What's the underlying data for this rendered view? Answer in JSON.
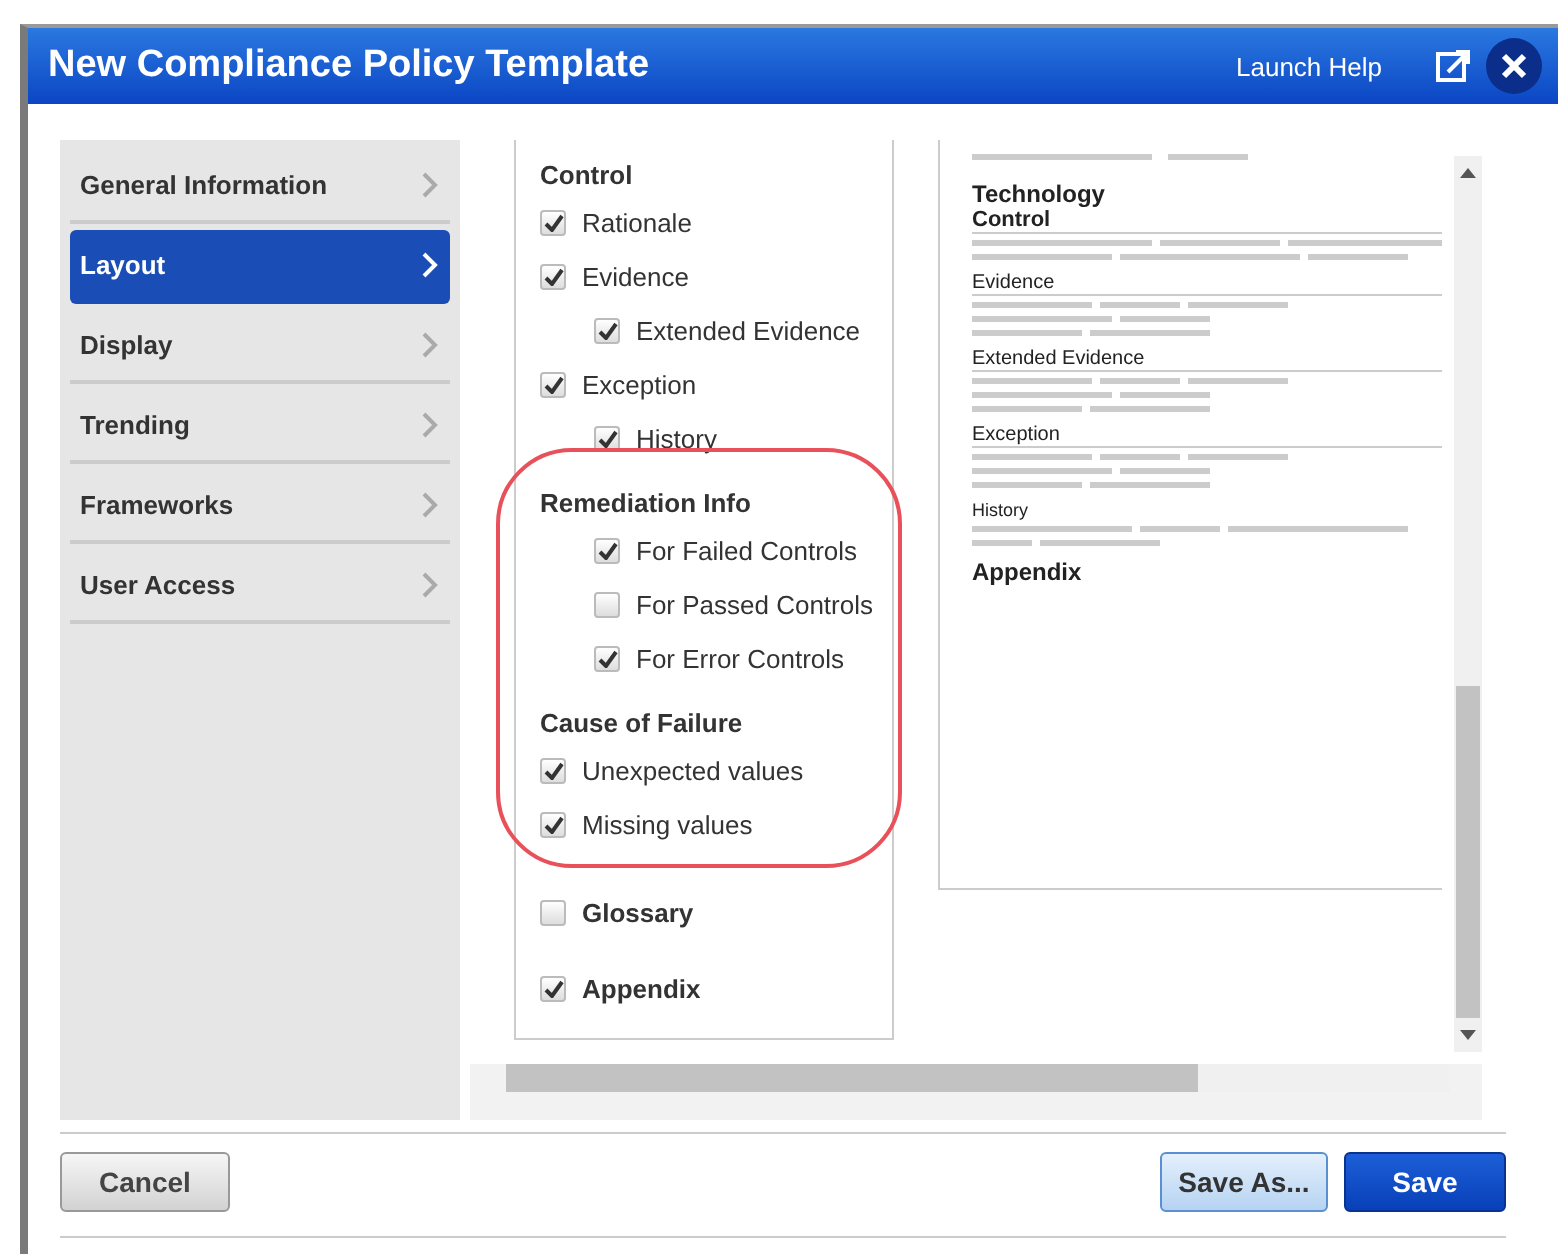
{
  "window": {
    "title": "New Compliance Policy Template",
    "help_link": "Launch Help"
  },
  "sidebar": {
    "items": [
      {
        "label": "General Information",
        "selected": false
      },
      {
        "label": "Layout",
        "selected": true
      },
      {
        "label": "Display",
        "selected": false
      },
      {
        "label": "Trending",
        "selected": false
      },
      {
        "label": "Frameworks",
        "selected": false
      },
      {
        "label": "User Access",
        "selected": false
      }
    ]
  },
  "options": [
    {
      "kind": "heading",
      "label": "Control",
      "children": [
        {
          "label": "Rationale",
          "checked": true
        },
        {
          "label": "Evidence",
          "checked": true,
          "children": [
            {
              "label": "Extended Evidence",
              "checked": true
            }
          ]
        },
        {
          "label": "Exception",
          "checked": true,
          "children": [
            {
              "label": "History",
              "checked": true
            }
          ]
        }
      ]
    },
    {
      "kind": "heading-deep",
      "label": "Remediation Info",
      "children": [
        {
          "label": "For Failed Controls",
          "checked": true
        },
        {
          "label": "For Passed Controls",
          "checked": false
        },
        {
          "label": "For Error Controls",
          "checked": true
        }
      ]
    },
    {
      "kind": "heading",
      "label": "Cause of Failure",
      "children": [
        {
          "label": "Unexpected values",
          "checked": true
        },
        {
          "label": "Missing values",
          "checked": true
        }
      ]
    },
    {
      "kind": "section",
      "label": "Glossary",
      "checked": false
    },
    {
      "kind": "section",
      "label": "Appendix",
      "checked": true
    }
  ],
  "preview": {
    "sections": [
      {
        "kind": "title",
        "label": "Technology"
      },
      {
        "kind": "heading",
        "label": "Control"
      },
      {
        "kind": "subheading",
        "label": "Evidence"
      },
      {
        "kind": "subheading",
        "label": "Extended Evidence"
      },
      {
        "kind": "subheading",
        "label": "Exception"
      },
      {
        "kind": "minor",
        "label": "History"
      },
      {
        "kind": "title",
        "label": "Appendix"
      }
    ]
  },
  "buttons": {
    "cancel": "Cancel",
    "save_as": "Save As...",
    "save": "Save"
  }
}
